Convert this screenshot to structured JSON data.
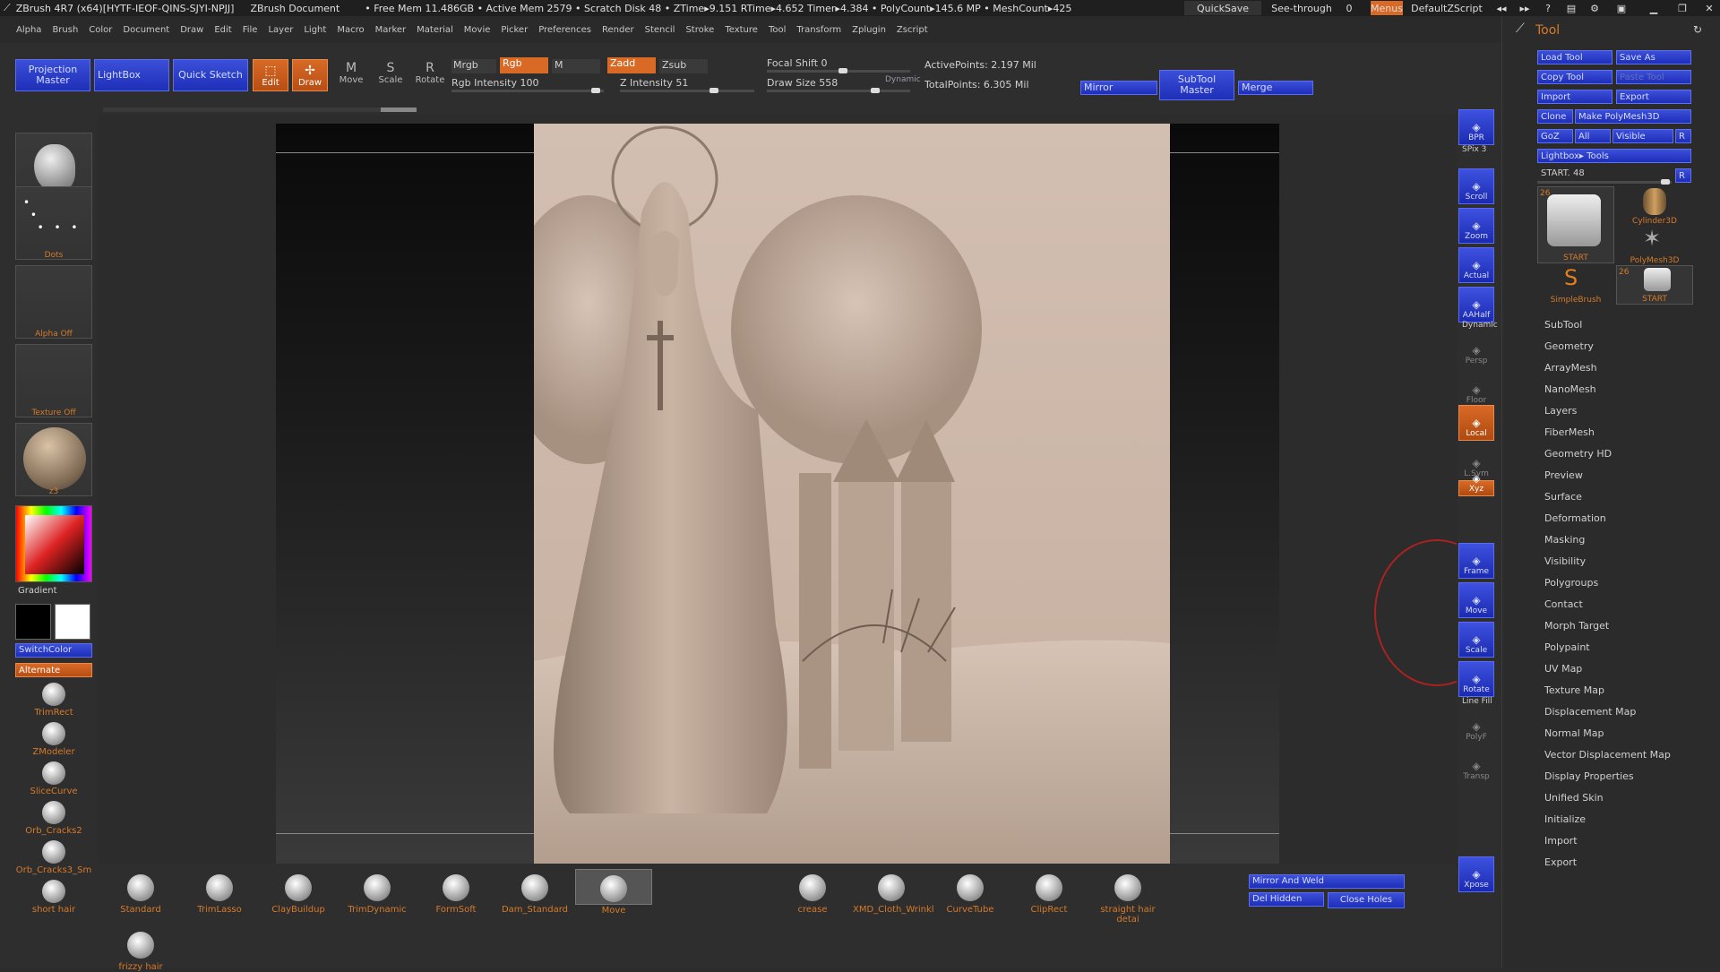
{
  "titlebar": {
    "app": "ZBrush 4R7 (x64)[HYTF-IEOF-QINS-SJYI-NPJJ]",
    "doc": "ZBrush Document",
    "stats": "• Free Mem 11.486GB • Active Mem 2579 • Scratch Disk 48 • ZTime▸9.151 RTime▸4.652 Timer▸4.384 • PolyCount▸145.6 MP • MeshCount▸425",
    "quicksave": "QuickSave",
    "seethrough": "See-through",
    "seethrough_val": "0",
    "menus": "Menus",
    "script": "DefaultZScript"
  },
  "menubar": [
    "Alpha",
    "Brush",
    "Color",
    "Document",
    "Draw",
    "Edit",
    "File",
    "Layer",
    "Light",
    "Macro",
    "Marker",
    "Material",
    "Movie",
    "Picker",
    "Preferences",
    "Render",
    "Stencil",
    "Stroke",
    "Texture",
    "Tool",
    "Transform",
    "Zplugin",
    "Zscript"
  ],
  "toolbar": {
    "projection_master": "Projection Master",
    "lightbox": "LightBox",
    "quick_sketch": "Quick Sketch",
    "edit": "Edit",
    "draw": "Draw",
    "move": "Move",
    "scale": "Scale",
    "rotate": "Rotate",
    "mrgb": "Mrgb",
    "rgb": "Rgb",
    "m": "M",
    "rgb_intensity": "Rgb Intensity 100",
    "zadd": "Zadd",
    "zsub": "Zsub",
    "z_intensity": "Z Intensity 51",
    "focal_shift": "Focal Shift 0",
    "draw_size": "Draw Size 558",
    "dynamic": "Dynamic",
    "active_points": "ActivePoints: 2.197 Mil",
    "total_points": "TotalPoints: 6.305 Mil",
    "mirror": "Mirror",
    "subtool_master": "SubTool Master",
    "merge": "Merge"
  },
  "left": {
    "dots": "Dots",
    "alpha_off": "Alpha Off",
    "texture_off": "Texture Off",
    "material": "z3",
    "gradient": "Gradient",
    "switchcolor": "SwitchColor",
    "alternate": "Alternate",
    "brushes": [
      "TrimRect",
      "ZModeler",
      "SliceCurve",
      "Orb_Cracks2",
      "Orb_Cracks3_Sm",
      "short hair"
    ]
  },
  "bottom": {
    "brushes": [
      "Standard",
      "TrimLasso",
      "ClayBuildup",
      "TrimDynamic",
      "FormSoft",
      "Dam_Standard",
      "Move",
      "crease",
      "XMD_Cloth_Wrinkl",
      "CurveTube",
      "ClipRect",
      "straight hair detai"
    ],
    "extra": "frizzy hair",
    "mirror_weld": "Mirror And Weld",
    "del_hidden": "Del Hidden",
    "close_holes": "Close Holes"
  },
  "shelf": {
    "bpr": "BPR",
    "spix": "SPix 3",
    "scroll": "Scroll",
    "zoom": "Zoom",
    "actual": "Actual",
    "aahalf": "AAHalf",
    "dynamic": "Dynamic",
    "persp": "Persp",
    "floor": "Floor",
    "local": "Local",
    "lsym": "L.Sym",
    "xyz": "Xyz",
    "frame": "Frame",
    "move": "Move",
    "scale": "Scale",
    "rotate": "Rotate",
    "linefill": "Line Fill",
    "polyf": "PolyF",
    "transp": "Transp",
    "xpose": "Xpose"
  },
  "tool": {
    "title": "Tool",
    "load_tool": "Load Tool",
    "save_as": "Save As",
    "copy_tool": "Copy Tool",
    "paste_tool": "Paste Tool",
    "import": "Import",
    "export": "Export",
    "clone": "Clone",
    "make_polymesh": "Make PolyMesh3D",
    "goz": "GoZ",
    "all": "All",
    "visible": "Visible",
    "r": "R",
    "lightbox_tools": "Lightbox▸ Tools",
    "start": "START. 48",
    "thumbs": [
      "START",
      "Cylinder3D",
      "PolyMesh3D",
      "SimpleBrush",
      "START"
    ],
    "thumb_counts": [
      "26",
      "26"
    ],
    "items": [
      "SubTool",
      "Geometry",
      "ArrayMesh",
      "NanoMesh",
      "Layers",
      "FiberMesh",
      "Geometry HD",
      "Preview",
      "Surface",
      "Deformation",
      "Masking",
      "Visibility",
      "Polygroups",
      "Contact",
      "Morph Target",
      "Polypaint",
      "UV Map",
      "Texture Map",
      "Displacement Map",
      "Normal Map",
      "Vector Displacement Map",
      "Display Properties",
      "Unified Skin",
      "Initialize",
      "Import",
      "Export"
    ]
  },
  "colors": {
    "accent_blue": "#2a3ccc",
    "accent_orange": "#d86a26",
    "relief": "#cbb6a7"
  }
}
